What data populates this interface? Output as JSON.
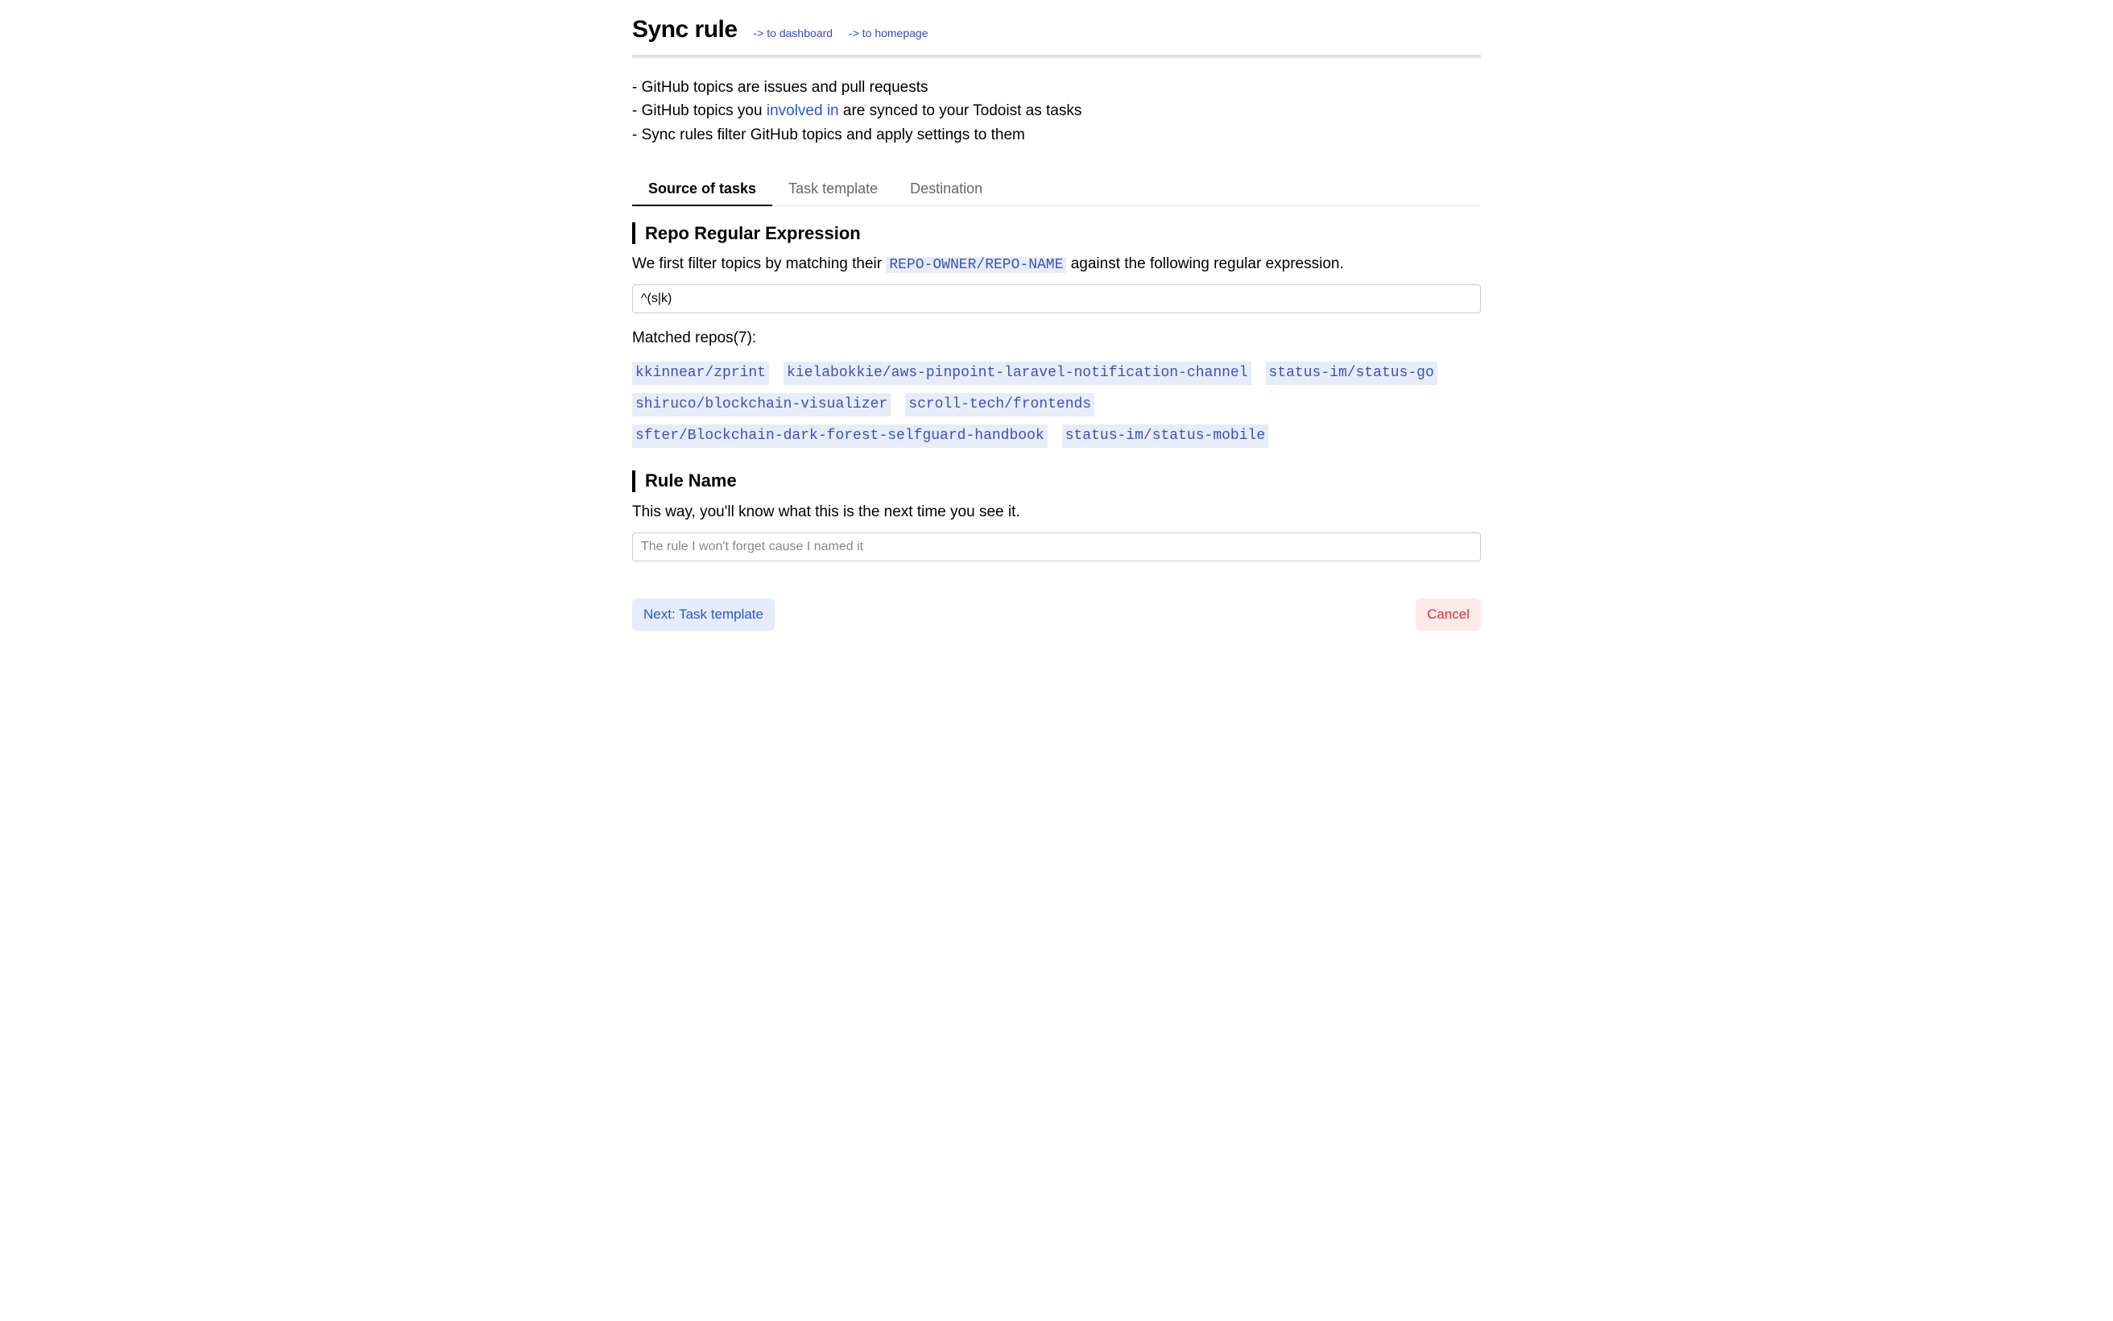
{
  "header": {
    "title": "Sync rule",
    "links": {
      "dashboard": "-> to dashboard",
      "homepage": "-> to homepage"
    }
  },
  "description": {
    "line1_prefix": "- GitHub topics are issues and pull requests",
    "line2_prefix": "- GitHub topics you ",
    "line2_link": "involved in",
    "line2_suffix": " are synced to your Todoist as tasks",
    "line3": "- Sync rules filter GitHub topics and apply settings to them"
  },
  "tabs": {
    "source": "Source of tasks",
    "template": "Task template",
    "destination": "Destination"
  },
  "repo_section": {
    "heading": "Repo Regular Expression",
    "para_prefix": "We first filter topics by matching their ",
    "code_token": "REPO-OWNER/REPO-NAME",
    "para_suffix": " against the following regular expression.",
    "regex_value": "^(s|k)",
    "matched_label": "Matched repos(7):",
    "repos": [
      "kkinnear/zprint",
      "kielabokkie/aws-pinpoint-laravel-notification-channel",
      "status-im/status-go",
      "shiruco/blockchain-visualizer",
      "scroll-tech/frontends",
      "sfter/Blockchain-dark-forest-selfguard-handbook",
      "status-im/status-mobile"
    ]
  },
  "rule_name_section": {
    "heading": "Rule Name",
    "para": "This way, you'll know what this is the next time you see it.",
    "placeholder": "The rule I won't forget cause I named it",
    "value": ""
  },
  "footer": {
    "next": "Next: Task template",
    "cancel": "Cancel"
  }
}
